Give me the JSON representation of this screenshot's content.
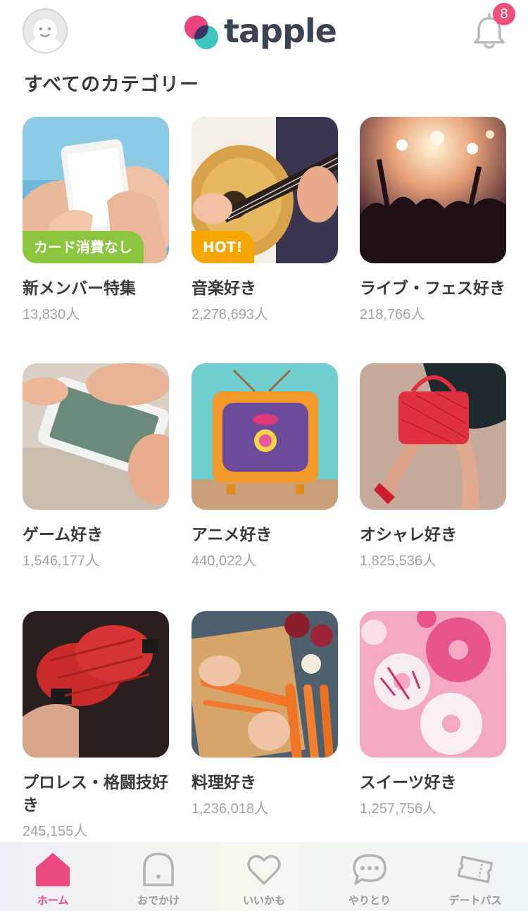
{
  "header": {
    "logo_text": "tapple",
    "notification_count": "8"
  },
  "section_title": "すべてのカテゴリー",
  "categories": [
    {
      "name": "新メンバー特集",
      "count": "13,830人",
      "tag": "カード消費なし"
    },
    {
      "name": "音楽好き",
      "count": "2,278,693人",
      "tag": "HOT!"
    },
    {
      "name": "ライブ・フェス好き",
      "count": "218,766人"
    },
    {
      "name": "ゲーム好き",
      "count": "1,546,177人"
    },
    {
      "name": "アニメ好き",
      "count": "440,022人"
    },
    {
      "name": "オシャレ好き",
      "count": "1,825,536人"
    },
    {
      "name": "プロレス・格闘技好き",
      "count": "245,155人"
    },
    {
      "name": "料理好き",
      "count": "1,236,018人"
    },
    {
      "name": "スイーツ好き",
      "count": "1,257,756人"
    }
  ],
  "tabbar": {
    "home": "ホーム",
    "odekake": "おでかけ",
    "iikamo": "いいかも",
    "yaritori": "やりとり",
    "datepass": "デートパス"
  },
  "colors": {
    "accent_pink": "#ea4a7e",
    "logo_pink": "#e8447f",
    "logo_teal": "#3fc5c0",
    "tag_green": "#8cc63f",
    "tag_orange": "#f7a600"
  }
}
